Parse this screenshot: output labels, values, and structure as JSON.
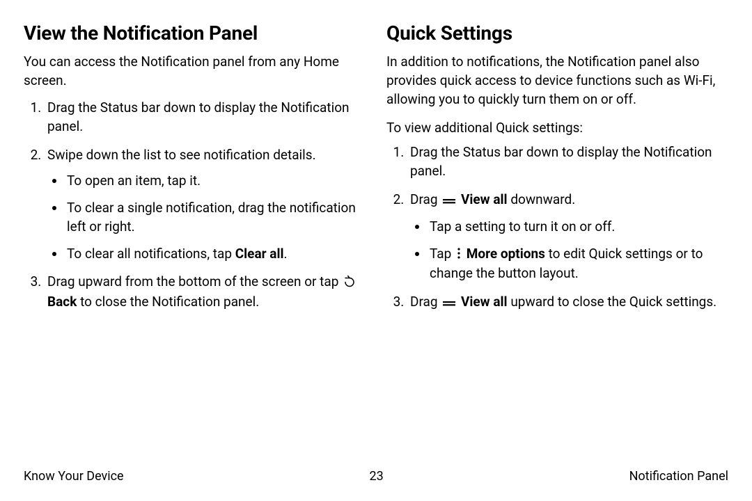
{
  "left": {
    "heading": "View the Notification Panel",
    "intro": "You can access the Notification panel from any Home screen.",
    "step1": "Drag the Status bar down to display the Notification panel.",
    "step2": "Swipe down the list to see notification details.",
    "step2_b1": "To open an item, tap it.",
    "step2_b2": "To clear a single notification, drag the notification left or right.",
    "step2_b3_a": "To clear all notifications, tap ",
    "step2_b3_bold": "Clear all",
    "step2_b3_b": ".",
    "step3_a": "Drag upward from the bottom of the screen or tap ",
    "step3_bold": "Back",
    "step3_b": " to close the Notification panel."
  },
  "right": {
    "heading": "Quick Settings",
    "intro": "In addition to notifications, the Notification panel also provides quick access to device functions such as Wi-Fi, allowing you to quickly turn them on or off.",
    "sub": "To view additional Quick settings:",
    "step1": "Drag the Status bar down to display the Notification panel.",
    "step2_a": "Drag ",
    "step2_bold": "View all",
    "step2_b": " downward.",
    "step2_bul1": "Tap a setting to turn it on or off.",
    "step2_bul2_a": "Tap ",
    "step2_bul2_bold": "More options",
    "step2_bul2_b": " to edit Quick settings or to change the button layout.",
    "step3_a": "Drag ",
    "step3_bold": "View all",
    "step3_b": " upward to close the Quick settings."
  },
  "footer": {
    "left": "Know Your Device",
    "center": "23",
    "right": "Notification Panel"
  }
}
